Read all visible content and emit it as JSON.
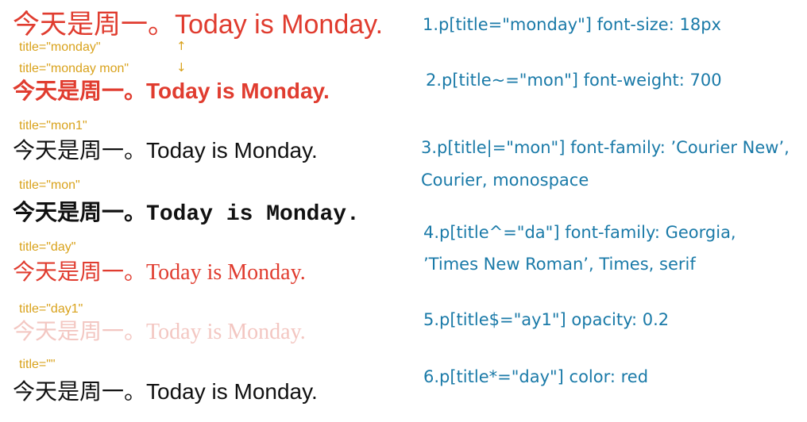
{
  "demo_lines": [
    {
      "cjk": "今天是周一。",
      "en": "Today is Monday."
    },
    {
      "cjk": "今天是周一。",
      "en": "Today is Monday."
    },
    {
      "cjk": "今天是周一。",
      "en": "Today is Monday."
    },
    {
      "cjk": "今天是周一。",
      "en": "Today is Monday."
    },
    {
      "cjk": "今天是周一。",
      "en": "Today is Monday."
    },
    {
      "cjk": "今天是周一。",
      "en": "Today is Monday."
    },
    {
      "cjk": "今天是周一。",
      "en": "Today is Monday."
    }
  ],
  "title_tags": [
    "title=\"monday\"",
    "title=\"monday mon\"",
    "title=\"mon1\"",
    "title=\"mon\"",
    "title=\"day\"",
    "title=\"day1\"",
    "title=\"\""
  ],
  "arrows": {
    "up": "↑",
    "down": "↓"
  },
  "rules": [
    "1.p[title=\"monday\"] font-size: 18px",
    "2.p[title~=\"mon\"] font-weight: 700",
    "3.p[title|=\"mon\"] font-family: ’Courier New’,",
    "Courier, monospace",
    "4.p[title^=\"da\"] font-family: Georgia,",
    "’Times New Roman’, Times, serif",
    "5.p[title$=\"ay1\"] opacity: 0.2",
    "6.p[title*=\"day\"] color: red"
  ],
  "colors": {
    "red": "#e03c2f",
    "faded_red": "#f3c7c2",
    "black": "#111111",
    "tag": "#d9a21b",
    "rule": "#1a7aa8"
  }
}
